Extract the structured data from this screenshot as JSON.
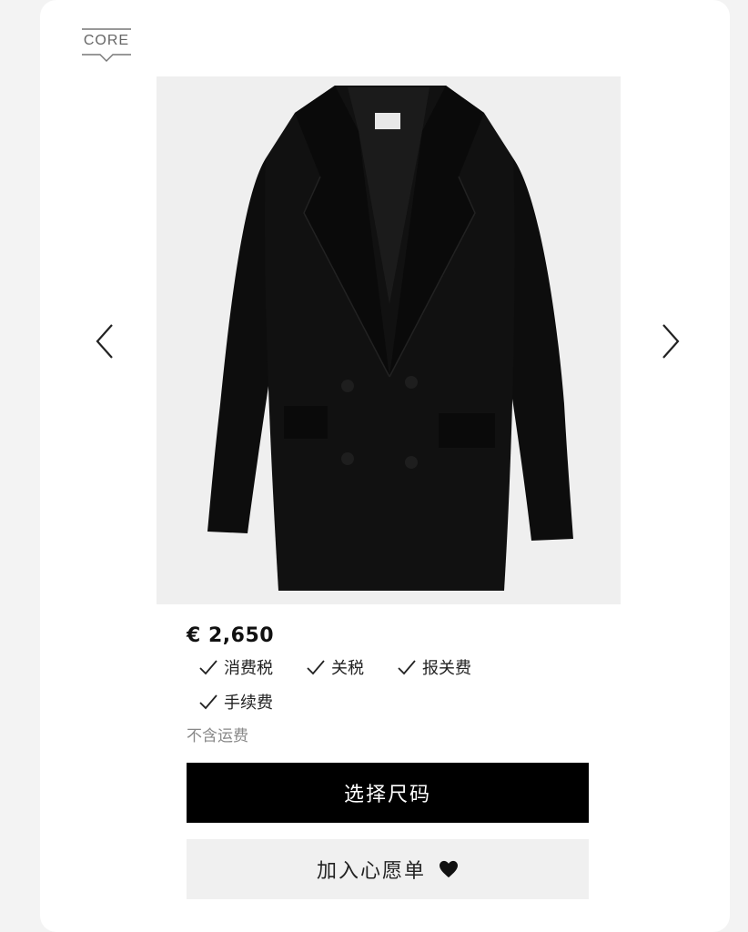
{
  "badge": {
    "label": "CORE"
  },
  "product": {
    "price": "€ 2,650",
    "included_fees": [
      "消费税",
      "关税",
      "报关费",
      "手续费"
    ],
    "shipping_note": "不含运费"
  },
  "actions": {
    "select_size_label": "选择尺码",
    "wishlist_label": "加入心愿单"
  },
  "icons": {
    "prev": "chevron-left-icon",
    "next": "chevron-right-icon",
    "check": "check-icon",
    "heart": "heart-icon"
  },
  "colors": {
    "primary_button": "#000000",
    "secondary_button": "#f0f0f0",
    "image_background": "#efefef"
  }
}
